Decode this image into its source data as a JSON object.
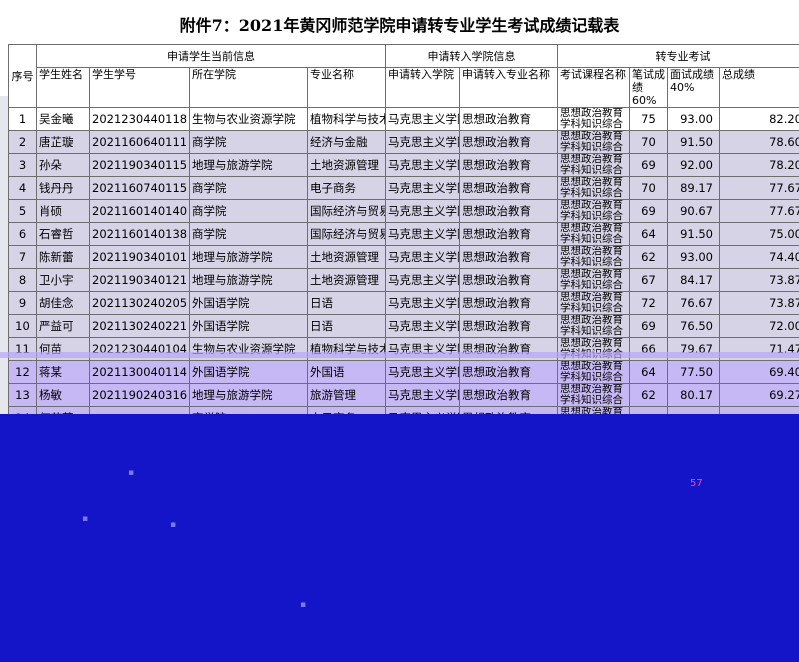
{
  "title": "附件7：2021年黄冈师范学院申请转专业学生考试成绩记载表",
  "headers": {
    "seq": "序号",
    "group_current": "申请学生当前信息",
    "group_target": "申请转入学院信息",
    "group_exam": "转专业考试",
    "name": "学生姓名",
    "student_id": "学生学号",
    "college": "所在学院",
    "major": "专业名称",
    "target_college": "申请转入学院",
    "target_major": "申请转入专业名称",
    "course": "考试课程名称",
    "written": "笔试成绩 60%",
    "interview": "面试成绩 40%",
    "total": "总成绩"
  },
  "rows": [
    {
      "seq": "1",
      "name": "吴金曦",
      "id": "2021230440118",
      "college": "生物与农业资源学院",
      "major": "植物科学与技术",
      "target_college": "马克思主义学院",
      "target_major": "思想政治教育",
      "course": "思想政治教育学科知识综合",
      "written": "75",
      "interview": "93.00",
      "total": "82.20"
    },
    {
      "seq": "2",
      "name": "唐芷璇",
      "id": "2021160640111",
      "college": "商学院",
      "major": "经济与金融",
      "target_college": "马克思主义学院",
      "target_major": "思想政治教育",
      "course": "思想政治教育学科知识综合",
      "written": "70",
      "interview": "91.50",
      "total": "78.60"
    },
    {
      "seq": "3",
      "name": "孙朵",
      "id": "2021190340115",
      "college": "地理与旅游学院",
      "major": "土地资源管理",
      "target_college": "马克思主义学院",
      "target_major": "思想政治教育",
      "course": "思想政治教育学科知识综合",
      "written": "69",
      "interview": "92.00",
      "total": "78.20"
    },
    {
      "seq": "4",
      "name": "钱丹丹",
      "id": "2021160740115",
      "college": "商学院",
      "major": "电子商务",
      "target_college": "马克思主义学院",
      "target_major": "思想政治教育",
      "course": "思想政治教育学科知识综合",
      "written": "70",
      "interview": "89.17",
      "total": "77.67"
    },
    {
      "seq": "5",
      "name": "肖硕",
      "id": "2021160140140",
      "college": "商学院",
      "major": "国际经济与贸易",
      "target_college": "马克思主义学院",
      "target_major": "思想政治教育",
      "course": "思想政治教育学科知识综合",
      "written": "69",
      "interview": "90.67",
      "total": "77.67"
    },
    {
      "seq": "6",
      "name": "石睿哲",
      "id": "2021160140138",
      "college": "商学院",
      "major": "国际经济与贸易",
      "target_college": "马克思主义学院",
      "target_major": "思想政治教育",
      "course": "思想政治教育学科知识综合",
      "written": "64",
      "interview": "91.50",
      "total": "75.00"
    },
    {
      "seq": "7",
      "name": "陈新蕾",
      "id": "2021190340101",
      "college": "地理与旅游学院",
      "major": "土地资源管理",
      "target_college": "马克思主义学院",
      "target_major": "思想政治教育",
      "course": "思想政治教育学科知识综合",
      "written": "62",
      "interview": "93.00",
      "total": "74.40"
    },
    {
      "seq": "8",
      "name": "卫小宇",
      "id": "2021190340121",
      "college": "地理与旅游学院",
      "major": "土地资源管理",
      "target_college": "马克思主义学院",
      "target_major": "思想政治教育",
      "course": "思想政治教育学科知识综合",
      "written": "67",
      "interview": "84.17",
      "total": "73.87"
    },
    {
      "seq": "9",
      "name": "胡佳念",
      "id": "2021130240205",
      "college": "外国语学院",
      "major": "日语",
      "target_college": "马克思主义学院",
      "target_major": "思想政治教育",
      "course": "思想政治教育学科知识综合",
      "written": "72",
      "interview": "76.67",
      "total": "73.87"
    },
    {
      "seq": "10",
      "name": "严益可",
      "id": "2021130240221",
      "college": "外国语学院",
      "major": "日语",
      "target_college": "马克思主义学院",
      "target_major": "思想政治教育",
      "course": "思想政治教育学科知识综合",
      "written": "69",
      "interview": "76.50",
      "total": "72.00"
    },
    {
      "seq": "11",
      "name": "何苗",
      "id": "2021230440104",
      "college": "生物与农业资源学院",
      "major": "植物科学与技术",
      "target_college": "马克思主义学院",
      "target_major": "思想政治教育",
      "course": "思想政治教育学科知识综合",
      "written": "66",
      "interview": "79.67",
      "total": "71.47"
    },
    {
      "seq": "12",
      "name": "蒋某",
      "id": "2021130040114",
      "college": "外国语学院",
      "major": "外国语",
      "target_college": "马克思主义学院",
      "target_major": "思想政治教育",
      "course": "思想政治教育学科知识综合",
      "written": "64",
      "interview": "77.50",
      "total": "69.40"
    },
    {
      "seq": "13",
      "name": "杨敏",
      "id": "2021190240316",
      "college": "地理与旅游学院",
      "major": "旅游管理",
      "target_college": "马克思主义学院",
      "target_major": "思想政治教育",
      "course": "思想政治教育学科知识综合",
      "written": "62",
      "interview": "80.17",
      "total": "69.27"
    },
    {
      "seq": "14",
      "name": "何苗芮",
      "id": "",
      "college": "商学院",
      "major": "电子商务",
      "target_college": "马克思主义学院",
      "target_major": "思想政治教育",
      "course": "思想政治教育学科知识综合",
      "written": "",
      "interview": "",
      "total": ""
    }
  ],
  "stray_mark": "57"
}
